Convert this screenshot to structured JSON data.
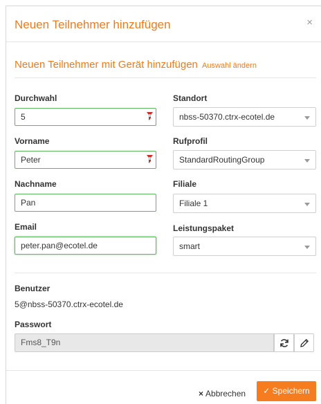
{
  "modal": {
    "title": "Neuen Teilnehmer hinzufügen",
    "close_glyph": "×",
    "section_title": "Neuen Teilnehmer mit Gerät hinzufügen",
    "change_link": "Auswahl ändern"
  },
  "form": {
    "durchwahl": {
      "label": "Durchwahl",
      "value": "5"
    },
    "vorname": {
      "label": "Vorname",
      "value": "Peter"
    },
    "nachname": {
      "label": "Nachname",
      "value": "Pan"
    },
    "email": {
      "label": "Email",
      "value": "peter.pan@ecotel.de"
    },
    "standort": {
      "label": "Standort",
      "value": "nbss-50370.ctrx-ecotel.de"
    },
    "rufprofil": {
      "label": "Rufprofil",
      "value": "StandardRoutingGroup"
    },
    "filiale": {
      "label": "Filiale",
      "value": "Filiale 1"
    },
    "leistungspaket": {
      "label": "Leistungspaket",
      "value": "smart"
    }
  },
  "account": {
    "benutzer_label": "Benutzer",
    "benutzer_value": "5@nbss-50370.ctrx-ecotel.de",
    "passwort_label": "Passwort",
    "passwort_value": "Fms8_T9n"
  },
  "footer": {
    "cancel_label": "Abbrechen",
    "save_label": "Speichern"
  },
  "colors": {
    "accent": "#f07a1a",
    "valid_border": "#5cb85c",
    "required_marker": "#c9302c"
  },
  "icons": [
    "close-icon",
    "required-marker-icon",
    "caret-down-icon",
    "refresh-icon",
    "pencil-icon",
    "times-icon",
    "check-icon"
  ]
}
